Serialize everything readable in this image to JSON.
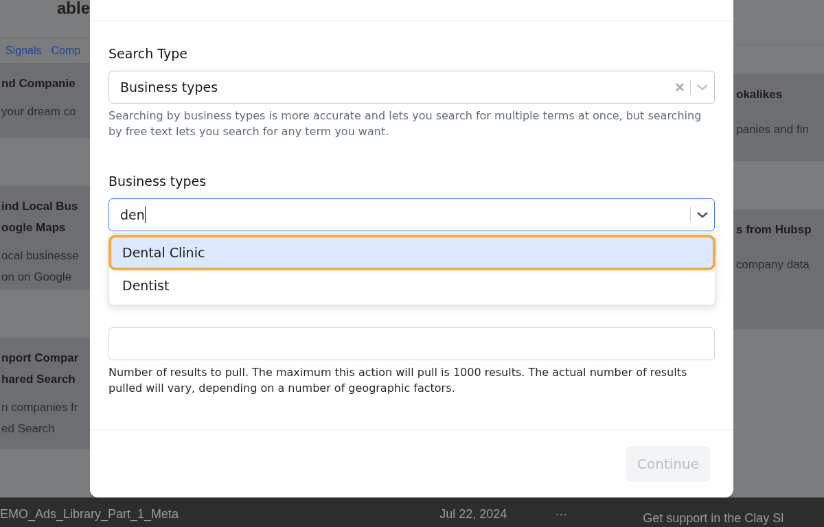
{
  "background": {
    "page_title": "able",
    "nav_links": [
      {
        "label": "Signals"
      },
      {
        "label": "Comp"
      }
    ],
    "left_cards": [
      {
        "title_lines": [
          "nd Companie"
        ],
        "description_lines": [
          "your dream co"
        ]
      },
      {
        "title_lines": [
          "ind Local Bus",
          "oogle Maps"
        ],
        "description_lines": [
          "ocal businesse",
          "on on Google"
        ]
      },
      {
        "title_lines": [
          "nport Compar",
          "hared Search"
        ],
        "description_lines": [
          "n companies fr",
          "ed Search"
        ]
      }
    ],
    "right_cards": [
      {
        "title_lines": [
          "okalikes"
        ],
        "description_lines": [
          "panies and fin"
        ]
      },
      {
        "title_lines": [
          "s from Hubsp"
        ],
        "description_lines": [
          "company data"
        ]
      }
    ],
    "bottom_bar": {
      "name": "EMO_Ads_Library_Part_1_Meta",
      "date": "Jul 22, 2024",
      "more": "···",
      "support": "Get support in the Clay Sl"
    }
  },
  "dialog": {
    "search_type": {
      "label": "Search Type",
      "value": "Business types",
      "help": "Searching by business types is more accurate and lets you search for multiple terms at once, but searching by free text lets you search for any term you want."
    },
    "business_types": {
      "label": "Business types",
      "value": "den",
      "focused": true,
      "options": [
        {
          "label": "Dental Clinic",
          "selected": true
        },
        {
          "label": "Dentist",
          "selected": false
        }
      ]
    },
    "results": {
      "help": "Number of results to pull. The maximum this action will pull is 1000 results. The actual number of results pulled will vary, depending on a number of geographic factors."
    },
    "continue_button": {
      "label": "Continue",
      "disabled": true
    }
  }
}
